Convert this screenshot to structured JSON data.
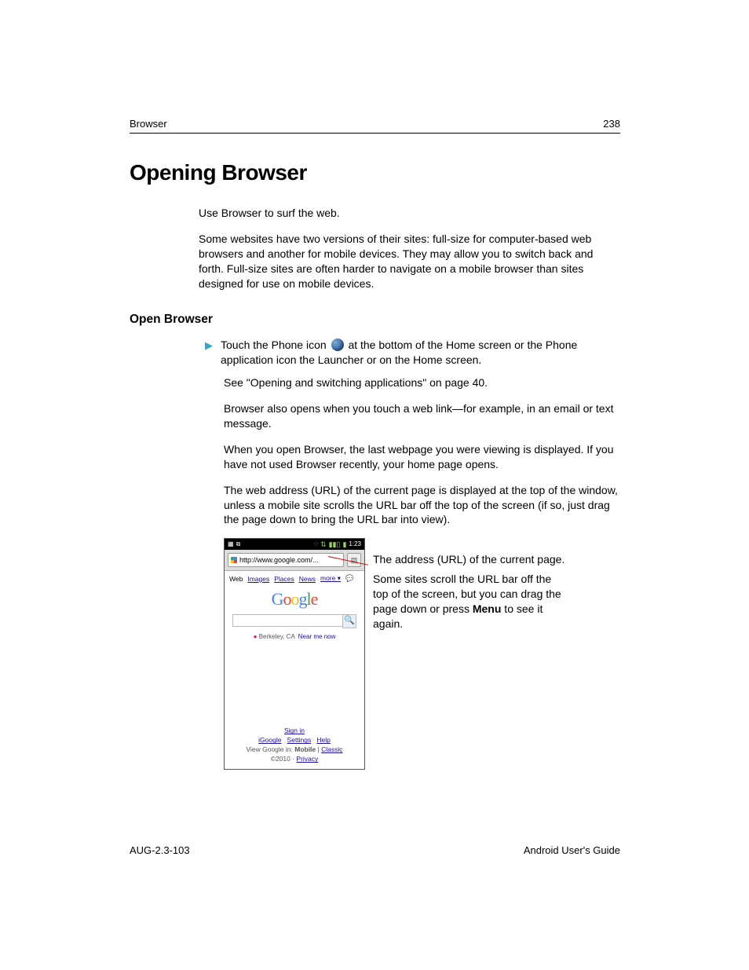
{
  "header": {
    "left": "Browser",
    "right": "238"
  },
  "title": "Opening Browser",
  "intro": {
    "p1": "Use Browser to surf the web.",
    "p2": "Some websites have two versions of their sites: full-size for computer-based web browsers and another for mobile devices. They may allow you to switch back and forth. Full-size sites are often harder to navigate on a mobile browser than sites designed for use on mobile devices."
  },
  "section_title": "Open Browser",
  "bullet": {
    "pre": "Touch the Phone icon ",
    "post": " at the bottom of the Home screen or the Phone application icon the Launcher or on the Home screen."
  },
  "para": {
    "see": "See \"Opening and switching applications\" on page 40.",
    "also": "Browser also opens when you touch a web link—for example, in an email or text message.",
    "open": "When you open Browser, the last webpage you were viewing is displayed. If you have not used Browser recently, your home page opens.",
    "url": "The web address (URL) of the current page is displayed at the top of the window, unless a mobile site scrolls the URL bar off the top of the screen (if so, just drag the page down to bring the URL bar into view)."
  },
  "phone": {
    "time": "1:23",
    "url": "http://www.google.com/...",
    "nav": {
      "web": "Web",
      "images": "Images",
      "places": "Places",
      "news": "News",
      "more": "more ▾"
    },
    "logo": {
      "g1": "G",
      "o1": "o",
      "o2": "o",
      "g2": "g",
      "l": "l",
      "e": "e"
    },
    "loc": {
      "dot": "●",
      "city": "Berkeley, CA",
      "near": "Near me now"
    },
    "signin": "Sign in",
    "links": {
      "igoogle": "iGoogle",
      "settings": "Settings",
      "help": "Help"
    },
    "viewin_pre": "View Google in: ",
    "viewin_bold": "Mobile",
    "viewin_sep": " | ",
    "viewin_classic": "Classic",
    "copy_pre": "©2010 · ",
    "copy_link": "Privacy"
  },
  "callout": {
    "c1": "The address (URL) of the current page.",
    "c2_pre": "Some sites scroll the URL bar off the top of the screen, but you can drag the page down or press ",
    "c2_bold": "Menu",
    "c2_post": " to see it again."
  },
  "footer": {
    "left": "AUG-2.3-103",
    "right": "Android User's Guide"
  }
}
